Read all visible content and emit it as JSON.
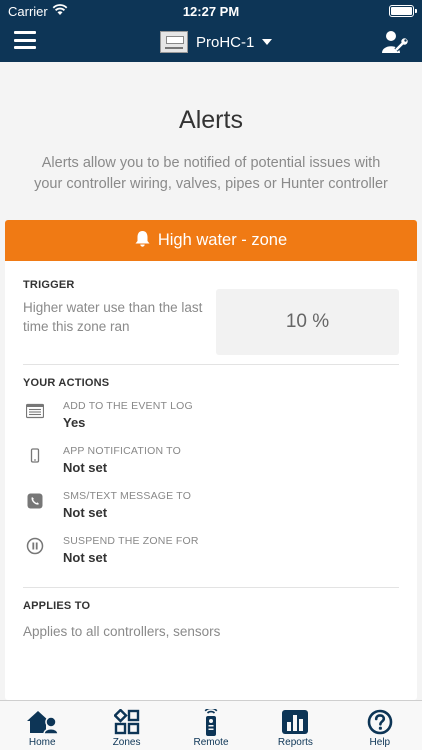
{
  "status_bar": {
    "carrier": "Carrier",
    "time": "12:27 PM"
  },
  "nav": {
    "controller_name": "ProHC-1"
  },
  "page": {
    "title": "Alerts",
    "description": "Alerts allow you to be notified of potential issues with your controller wiring, valves, pipes or Hunter controller"
  },
  "alert": {
    "title": "High water - zone",
    "header_color": "#f07a14",
    "trigger": {
      "heading": "TRIGGER",
      "text": "Higher water use than the last time this zone ran",
      "value": "10 %"
    },
    "actions": {
      "heading": "YOUR ACTIONS",
      "items": [
        {
          "label": "ADD TO THE EVENT LOG",
          "value": "Yes",
          "icon": "event-log-icon"
        },
        {
          "label": "APP NOTIFICATION TO",
          "value": "Not set",
          "icon": "phone-icon"
        },
        {
          "label": "SMS/TEXT MESSAGE TO",
          "value": "Not set",
          "icon": "sms-icon"
        },
        {
          "label": "SUSPEND THE ZONE FOR",
          "value": "Not set",
          "icon": "pause-icon"
        }
      ]
    },
    "applies_to": {
      "heading": "APPLIES TO",
      "text": "Applies to all controllers, sensors"
    }
  },
  "tabs": [
    {
      "label": "Home",
      "icon": "home-icon"
    },
    {
      "label": "Zones",
      "icon": "zones-icon"
    },
    {
      "label": "Remote",
      "icon": "remote-icon"
    },
    {
      "label": "Reports",
      "icon": "reports-icon"
    },
    {
      "label": "Help",
      "icon": "help-icon"
    }
  ],
  "colors": {
    "brand_navy": "#0d3556",
    "alert_orange": "#f07a14"
  }
}
